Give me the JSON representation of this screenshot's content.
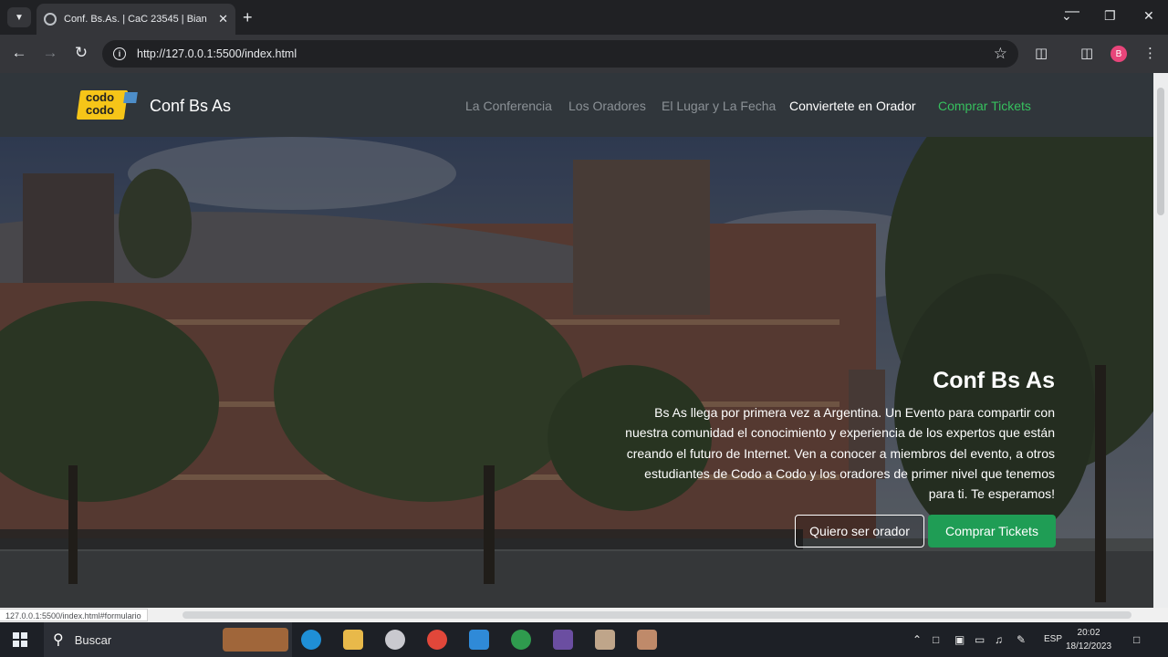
{
  "browser": {
    "tab_title": "Conf. Bs.As. | CaC 23545 | Bian",
    "url": "http://127.0.0.1:5500/index.html",
    "profile_initial": "B",
    "status_url": "127.0.0.1:5500/index.html#formulario"
  },
  "site": {
    "logo_line1": "codo",
    "logo_line2": "codo",
    "brand": "Conf Bs As",
    "nav": [
      {
        "label": "La Conferencia"
      },
      {
        "label": "Los Oradores"
      },
      {
        "label": "El Lugar y La Fecha"
      },
      {
        "label": "Conviertete en Orador"
      },
      {
        "label": "Comprar Tickets"
      }
    ]
  },
  "hero": {
    "title": "Conf Bs As",
    "text": "Bs As llega por primera vez a Argentina. Un Evento para compartir con nuestra comunidad el conocimiento y experiencia de los expertos que están creando el futuro de Internet. Ven a conocer a miembros del evento, a otros estudiantes de Codo a Codo y los oradores de primer nivel que tenemos para ti. Te esperamos!",
    "btn_speaker": "Quiero ser orador",
    "btn_tickets": "Comprar Tickets"
  },
  "taskbar": {
    "search_label": "Buscar",
    "lang": "ESP",
    "time": "20:02",
    "date": "18/12/2023"
  },
  "colors": {
    "accent_green": "#36c05e",
    "button_green": "#1f9d55",
    "logo_yellow": "#f6c518"
  }
}
